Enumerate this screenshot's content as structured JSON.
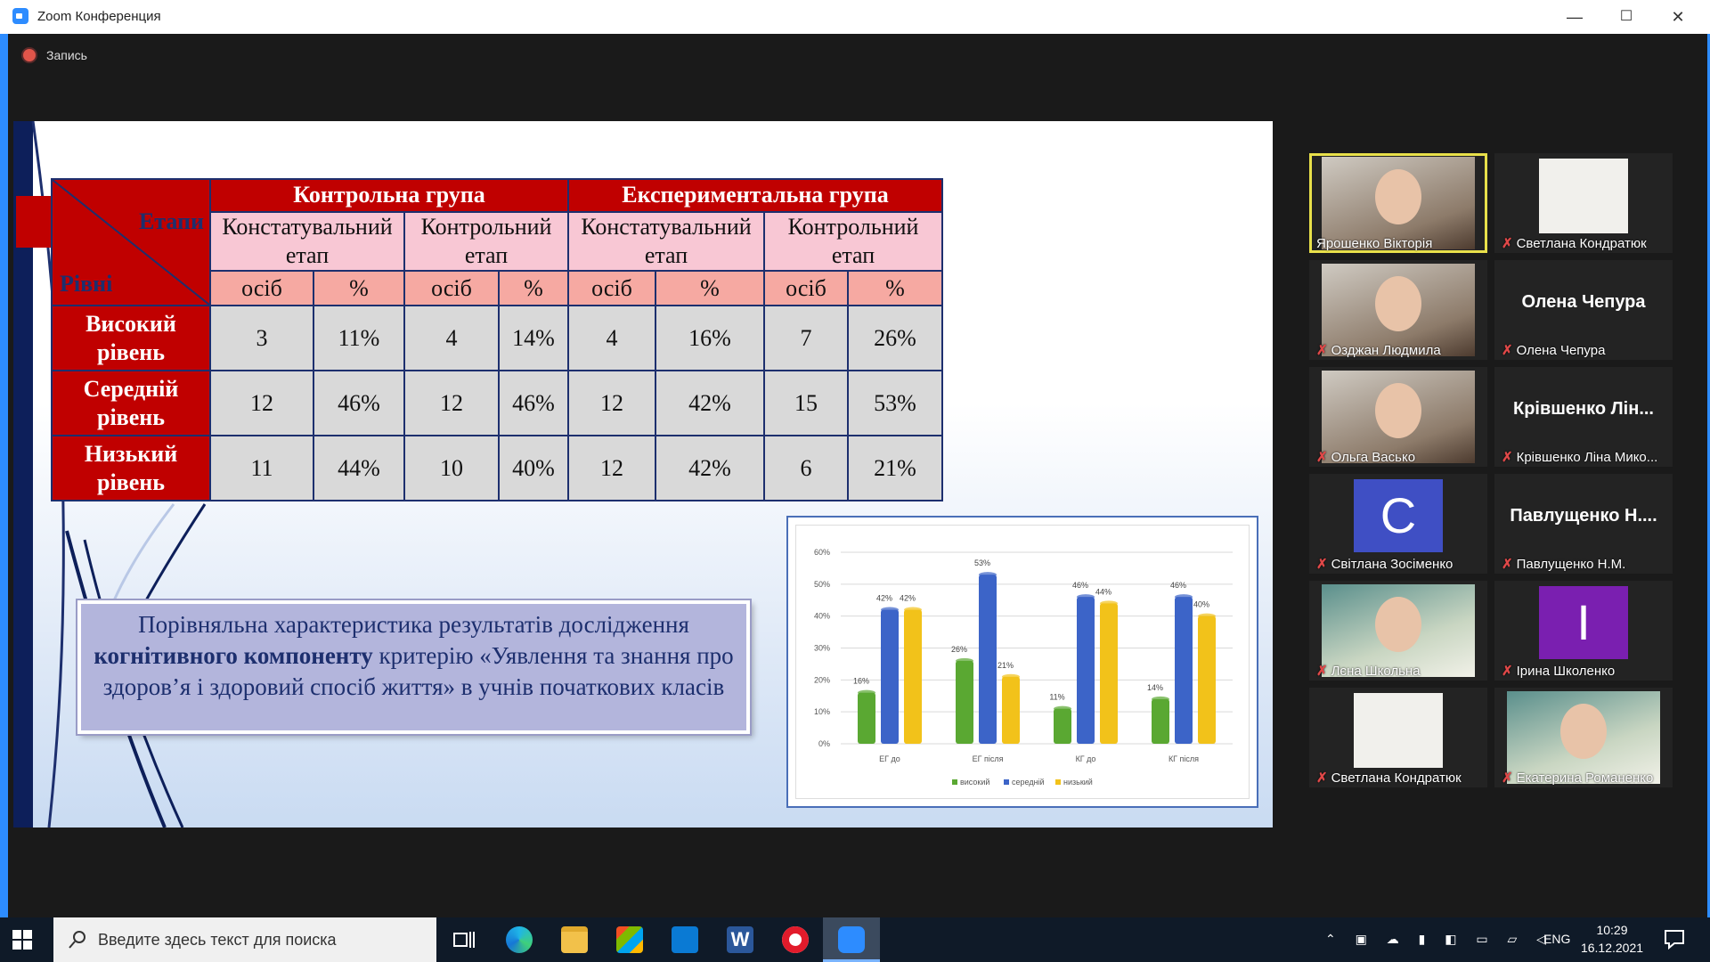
{
  "window": {
    "title": "Zoom Конференция",
    "minimize": "—",
    "maximize": "☐",
    "close": "✕"
  },
  "recording": {
    "label": "Запись"
  },
  "slide": {
    "table": {
      "corner_top": "Етапи",
      "corner_bottom": "Рівні",
      "groups": [
        "Контрольна група",
        "Експериментальна група"
      ],
      "stages": [
        "Констатувальний етап",
        "Контрольний етап",
        "Констатувальний етап",
        "Контрольний етап"
      ],
      "subheaders": [
        "осіб",
        "%",
        "осіб",
        "%",
        "осіб",
        "%",
        "осіб",
        "%"
      ],
      "rows": [
        {
          "label": "Високий рівень",
          "cells": [
            "3",
            "11%",
            "4",
            "14%",
            "4",
            "16%",
            "7",
            "26%"
          ]
        },
        {
          "label": "Середній рівень",
          "cells": [
            "12",
            "46%",
            "12",
            "46%",
            "12",
            "42%",
            "15",
            "53%"
          ]
        },
        {
          "label": "Низький рівень",
          "cells": [
            "11",
            "44%",
            "10",
            "40%",
            "12",
            "42%",
            "6",
            "21%"
          ]
        }
      ]
    },
    "caption": {
      "part1": "Порівняльна характеристика результатів дослідження ",
      "bold": "когнітивного компоненту",
      "part2": " критерію «Уявлення та знання про здоров’я і здоровий спосіб життя» в учнів початкових класів"
    }
  },
  "chart_data": {
    "type": "bar",
    "categories": [
      "ЕГ до",
      "ЕГ після",
      "КГ до",
      "КГ після"
    ],
    "series": [
      {
        "name": "високий",
        "color": "#5aa832",
        "values": [
          16,
          26,
          11,
          14
        ]
      },
      {
        "name": "середній",
        "color": "#3c64c8",
        "values": [
          42,
          53,
          46,
          46
        ]
      },
      {
        "name": "низький",
        "color": "#f2c21a",
        "values": [
          42,
          21,
          44,
          40
        ]
      }
    ],
    "ylim": [
      0,
      60
    ],
    "yticks": [
      "0%",
      "10%",
      "20%",
      "30%",
      "40%",
      "50%",
      "60%"
    ],
    "data_labels": [
      [
        "16%",
        "42%",
        "42%"
      ],
      [
        "26%",
        "53%",
        "21%"
      ],
      [
        "11%",
        "46%",
        "44%"
      ],
      [
        "14%",
        "46%",
        "40%"
      ]
    ],
    "legend_position": "bottom",
    "grid": true
  },
  "participants": [
    {
      "name": "Ярошенко Вікторія",
      "type": "video",
      "active": true,
      "muted": false
    },
    {
      "name": "Светлана Кондратюк",
      "type": "blank",
      "muted": true
    },
    {
      "name": "Озджан Людмила",
      "type": "video",
      "muted": true
    },
    {
      "name": "Олена Чепура",
      "type": "text",
      "display": "Олена Чепура",
      "muted": true
    },
    {
      "name": "Ольга Васько",
      "type": "video",
      "muted": true
    },
    {
      "name": "Крівшенко Ліна Мико...",
      "type": "text",
      "display": "Крівшенко Лін...",
      "muted": true
    },
    {
      "name": "Світлана Зосіменко",
      "type": "avatar",
      "letter": "С",
      "color": "#3f4fc4",
      "muted": true
    },
    {
      "name": "Павлущенко Н.М.",
      "type": "text",
      "display": "Павлущенко Н....",
      "muted": true
    },
    {
      "name": "Лєна Школьна",
      "type": "photo",
      "muted": true
    },
    {
      "name": "Ірина Школенко",
      "type": "avatar",
      "letter": "І",
      "color": "#7a1fb0",
      "muted": true
    },
    {
      "name": "Светлана Кондратюк",
      "type": "blank",
      "muted": true
    },
    {
      "name": "Екатерина Романенко",
      "type": "photo",
      "muted": true
    }
  ],
  "taskbar": {
    "search_placeholder": "Введите здесь текст для поиска",
    "lang": "ENG",
    "time": "10:29",
    "date": "16.12.2021"
  }
}
